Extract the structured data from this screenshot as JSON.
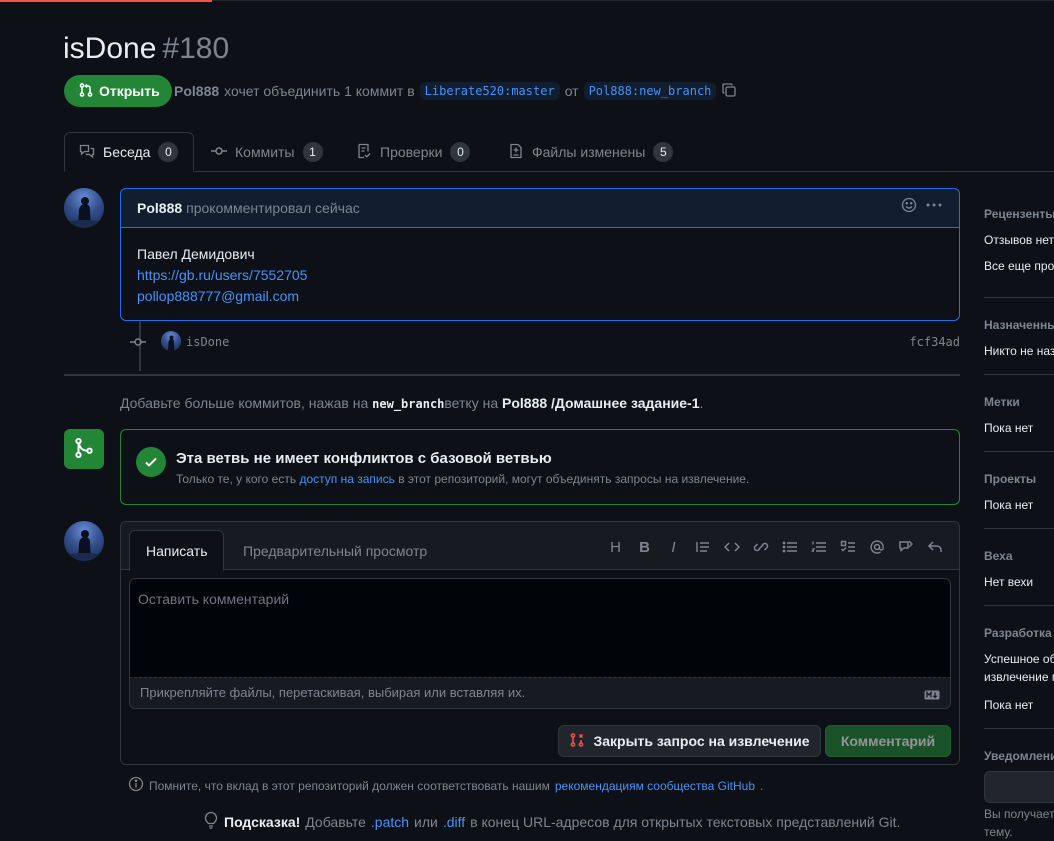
{
  "pr": {
    "title": "isDone",
    "number": "#180",
    "state": "Открыть",
    "author": "Pol888",
    "meta_text": "хочет объединить 1 коммит в",
    "base_branch": "Liberate520:master",
    "from_word": "от",
    "head_branch": "Pol888:new_branch"
  },
  "tabs": [
    {
      "label": "Беседа",
      "count": "0"
    },
    {
      "label": "Коммиты",
      "count": "1"
    },
    {
      "label": "Проверки",
      "count": "0"
    },
    {
      "label": "Файлы изменены",
      "count": "5"
    }
  ],
  "comment": {
    "author": "Pol888",
    "action": "прокомментировал сейчас",
    "line1": "Павел Демидович",
    "link": "https://gb.ru/users/7552705",
    "email": "pollop888777@gmail.com"
  },
  "commit": {
    "message": "isDone",
    "sha": "fcf34ad"
  },
  "hint": {
    "prefix": "Добавьте больше коммитов, нажав на",
    "branch": "new_branch",
    "middle": "ветку на",
    "repo": "Pol888 /Домашнее задание-1",
    "suffix": "."
  },
  "merge": {
    "title": "Эта ветвь не имеет конфликтов с базовой ветвью",
    "sub_prefix": "Только те, у кого есть",
    "sub_link": "доступ на запись",
    "sub_suffix": "в этот репозиторий, могут объединять запросы на извлечение."
  },
  "editor": {
    "tab_write": "Написать",
    "tab_preview": "Предварительный просмотр",
    "placeholder": "Оставить комментарий",
    "attach_text": "Прикрепляйте файлы, перетаскивая, выбирая или вставляя их.",
    "close_button": "Закрыть запрос на извлечение",
    "comment_button": "Комментарий",
    "toolbar": [
      "H",
      "B",
      "I"
    ]
  },
  "remember": {
    "prefix": "Помните, что вклад в этот репозиторий должен соответствовать нашим",
    "link": "рекомендациям сообщества GitHub",
    "suffix": "."
  },
  "protip": {
    "bold": "Подсказка!",
    "text1": "Добавьте",
    "patch": ".patch",
    "or": "или",
    "diff": ".diff",
    "text2": "в конец URL-адресов для открытых текстовых представлений Git."
  },
  "sidebar": {
    "reviewers_h": "Рецензенты",
    "reviewers_1": "Отзывов нет",
    "reviewers_2": "Все еще продолжается",
    "assignees_h": "Назначенные",
    "assignees_t": "Никто не назначен",
    "labels_h": "Метки",
    "labels_t": "Пока нет",
    "projects_h": "Проекты",
    "projects_t": "Пока нет",
    "milestone_h": "Веха",
    "milestone_t": "Нет вехи",
    "dev_h": "Разработка",
    "dev_1": "Успешное объединение",
    "dev_2": "извлечение может",
    "dev_3": "Пока нет",
    "notif_h": "Уведомления",
    "notif_1": "Вы получаете",
    "notif_2": "тему."
  }
}
